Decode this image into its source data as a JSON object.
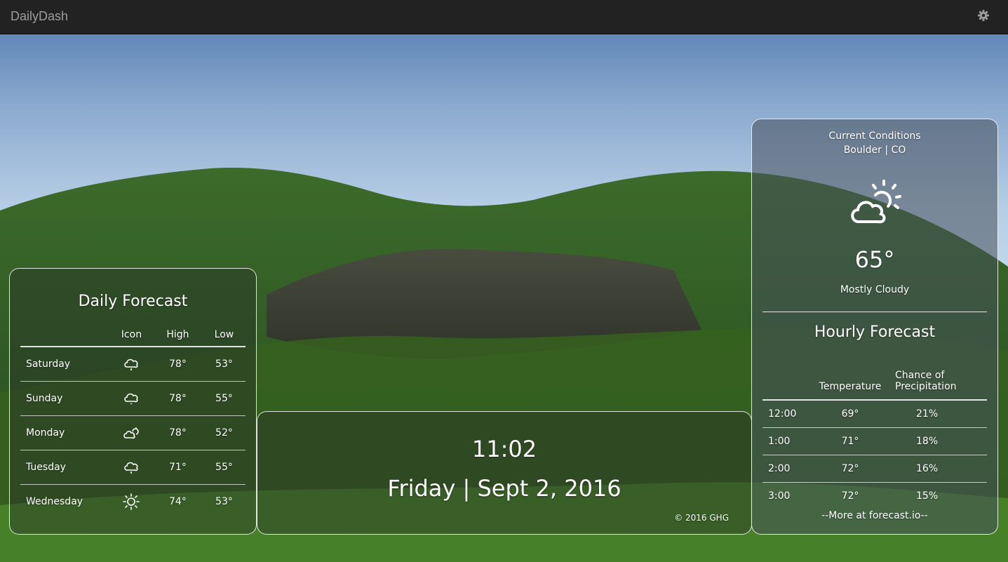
{
  "navbar": {
    "brand": "DailyDash",
    "settings_icon": "gear-icon"
  },
  "daily_forecast": {
    "title": "Daily Forecast",
    "columns": [
      "",
      "Icon",
      "High",
      "Low"
    ],
    "rows": [
      {
        "day": "Saturday",
        "icon": "cloud-drizzle-icon",
        "high": "78°",
        "low": "53°"
      },
      {
        "day": "Sunday",
        "icon": "cloud-icon",
        "high": "78°",
        "low": "55°"
      },
      {
        "day": "Monday",
        "icon": "partly-cloudy-icon",
        "high": "78°",
        "low": "52°"
      },
      {
        "day": "Tuesday",
        "icon": "cloud-drizzle-icon",
        "high": "71°",
        "low": "55°"
      },
      {
        "day": "Wednesday",
        "icon": "sun-icon",
        "high": "74°",
        "low": "53°"
      }
    ]
  },
  "clock": {
    "time": "11:02",
    "date": "Friday | Sept 2, 2016",
    "copyright": "© 2016 GHG"
  },
  "current": {
    "title": "Current Conditions",
    "location": "Boulder | CO",
    "icon": "partly-cloudy-icon",
    "temperature": "65°",
    "summary": "Mostly Cloudy"
  },
  "hourly_forecast": {
    "title": "Hourly Forecast",
    "columns": [
      "",
      "Temperature",
      "Chance of Precipitation"
    ],
    "rows": [
      {
        "hour": "12:00",
        "temp": "69°",
        "precip": "21%"
      },
      {
        "hour": "1:00",
        "temp": "71°",
        "precip": "18%"
      },
      {
        "hour": "2:00",
        "temp": "72°",
        "precip": "16%"
      },
      {
        "hour": "3:00",
        "temp": "72°",
        "precip": "15%"
      }
    ],
    "more_link": "--More at forecast.io--"
  }
}
